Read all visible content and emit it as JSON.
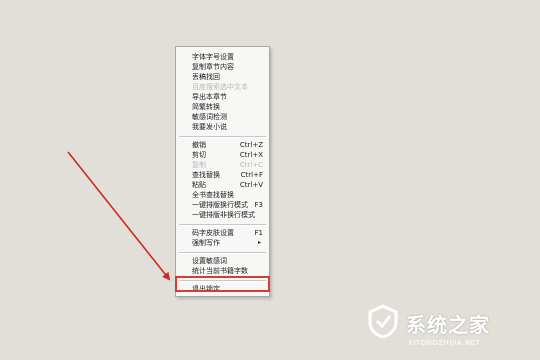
{
  "menu": {
    "items": [
      {
        "label": "字体字号设置",
        "shortcut": "",
        "disabled": false
      },
      {
        "label": "复制章节内容",
        "shortcut": "",
        "disabled": false
      },
      {
        "label": "丢稿找回",
        "shortcut": "",
        "disabled": false
      },
      {
        "label": "百度搜索选中文本",
        "shortcut": "",
        "disabled": true
      },
      {
        "label": "导出本章节",
        "shortcut": "",
        "disabled": false
      },
      {
        "label": "简繁转换",
        "shortcut": "",
        "disabled": false
      },
      {
        "label": "敏感词检测",
        "shortcut": "",
        "disabled": false
      },
      {
        "label": "我要发小说",
        "shortcut": "",
        "disabled": false
      },
      {
        "label": "撤销",
        "shortcut": "Ctrl+Z",
        "disabled": false
      },
      {
        "label": "剪切",
        "shortcut": "Ctrl+X",
        "disabled": false
      },
      {
        "label": "复制",
        "shortcut": "Ctrl+C",
        "disabled": true
      },
      {
        "label": "查找替换",
        "shortcut": "Ctrl+F",
        "disabled": false
      },
      {
        "label": "粘贴",
        "shortcut": "Ctrl+V",
        "disabled": false
      },
      {
        "label": "全书查找替换",
        "shortcut": "",
        "disabled": false
      },
      {
        "label": "一键排版换行模式",
        "shortcut": "F3",
        "disabled": false
      },
      {
        "label": "一键排版非换行模式",
        "shortcut": "",
        "disabled": false
      },
      {
        "label": "码字皮肤设置",
        "shortcut": "F1",
        "disabled": false
      },
      {
        "label": "强制写作",
        "shortcut": "▸",
        "disabled": false
      },
      {
        "label": "设置敏感词",
        "shortcut": "",
        "disabled": false
      },
      {
        "label": "统计当前书籍字数",
        "shortcut": "",
        "disabled": false
      },
      {
        "label": "退出锁定",
        "shortcut": "",
        "disabled": false
      }
    ]
  },
  "watermark": {
    "title": "系统之家",
    "subtitle": "XITONGZHIJIA.NET"
  },
  "colors": {
    "background": "#e2dfd9",
    "highlight": "#d83a34",
    "arrow": "#cf2a26"
  }
}
